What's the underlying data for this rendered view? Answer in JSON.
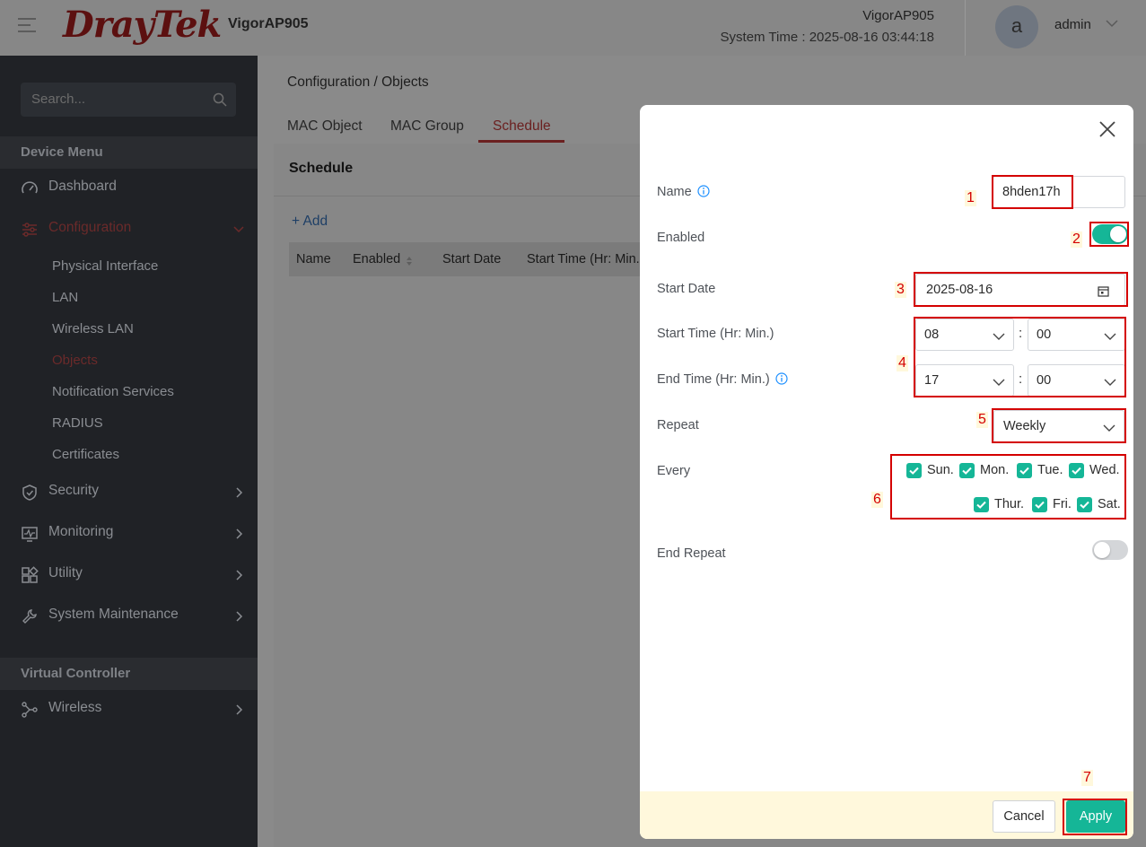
{
  "header": {
    "logo": "DrayTek",
    "model": "VigorAP905",
    "device_name": "VigorAP905",
    "system_time": "System Time : 2025-08-16 03:44:18",
    "avatar_letter": "a",
    "user": "admin"
  },
  "sidebar": {
    "search_placeholder": "Search...",
    "device_menu_title": "Device Menu",
    "items": [
      {
        "label": "Dashboard",
        "icon": "gauge-icon"
      },
      {
        "label": "Configuration",
        "icon": "sliders-icon",
        "active": true
      },
      {
        "label": "Security",
        "icon": "shield-icon"
      },
      {
        "label": "Monitoring",
        "icon": "monitor-icon"
      },
      {
        "label": "Utility",
        "icon": "grid-icon"
      },
      {
        "label": "System Maintenance",
        "icon": "wrench-icon"
      }
    ],
    "config_sub": [
      "Physical Interface",
      "LAN",
      "Wireless LAN",
      "Objects",
      "Notification Services",
      "RADIUS",
      "Certificates"
    ],
    "virtual_controller_title": "Virtual Controller",
    "wireless_label": "Wireless"
  },
  "content": {
    "breadcrumb": "Configuration / Objects",
    "tabs": [
      "MAC Object",
      "MAC Group",
      "Schedule"
    ],
    "active_tab": "Schedule",
    "panel_title": "Schedule",
    "add_label": "+ Add",
    "columns": [
      "Name",
      "Enabled",
      "Start Date",
      "Start Time (Hr: Min."
    ]
  },
  "modal": {
    "name_label": "Name",
    "name_value": "8hden17h",
    "enabled_label": "Enabled",
    "enabled": true,
    "start_date_label": "Start Date",
    "start_date_value": "2025-08-16",
    "start_time_label": "Start Time (Hr: Min.)",
    "start_hour": "08",
    "start_min": "00",
    "end_time_label": "End Time (Hr: Min.)",
    "end_hour": "17",
    "end_min": "00",
    "colon": ":",
    "repeat_label": "Repeat",
    "repeat_value": "Weekly",
    "every_label": "Every",
    "days": [
      {
        "label": "Sun.",
        "checked": true
      },
      {
        "label": "Mon.",
        "checked": true
      },
      {
        "label": "Tue.",
        "checked": true
      },
      {
        "label": "Wed.",
        "checked": true
      },
      {
        "label": "Thur.",
        "checked": true
      },
      {
        "label": "Fri.",
        "checked": true
      },
      {
        "label": "Sat.",
        "checked": true
      }
    ],
    "end_repeat_label": "End Repeat",
    "end_repeat": false,
    "cancel_label": "Cancel",
    "apply_label": "Apply"
  },
  "annotations": [
    "1",
    "2",
    "3",
    "4",
    "5",
    "6",
    "7"
  ],
  "colors": {
    "accent": "#15b697",
    "annotation_red": "#d40000",
    "footer_bg": "#fff8dc",
    "brand_red": "#b01c1c"
  }
}
